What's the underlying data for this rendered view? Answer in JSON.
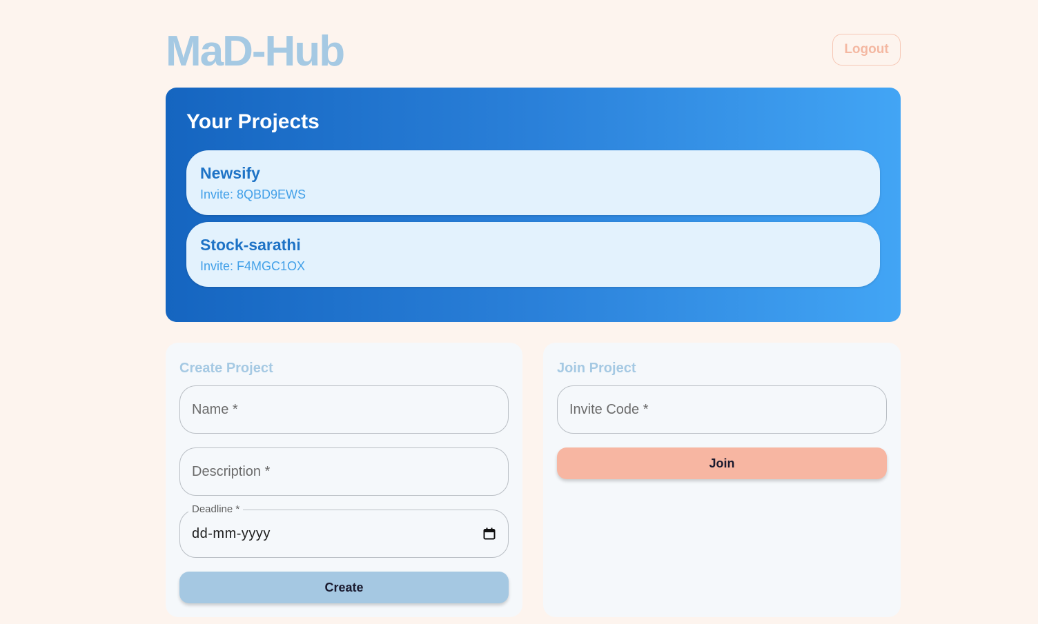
{
  "header": {
    "logo": "MaD-Hub",
    "logout_label": "Logout"
  },
  "projects": {
    "title": "Your Projects",
    "items": [
      {
        "name": "Newsify",
        "invite": "Invite: 8QBD9EWS"
      },
      {
        "name": "Stock-sarathi",
        "invite": "Invite: F4MGC1OX"
      }
    ]
  },
  "create": {
    "title": "Create Project",
    "name_placeholder": "Name *",
    "description_placeholder": "Description *",
    "deadline_label": "Deadline *",
    "deadline_value": "dd-mm-yyyy",
    "button_label": "Create"
  },
  "join": {
    "title": "Join Project",
    "invite_placeholder": "Invite Code *",
    "button_label": "Join"
  },
  "colors": {
    "background": "#fdf4ee",
    "logo": "#a5c9e3",
    "accent_blue": "#1565c0",
    "accent_peach": "#f7b6a2"
  }
}
